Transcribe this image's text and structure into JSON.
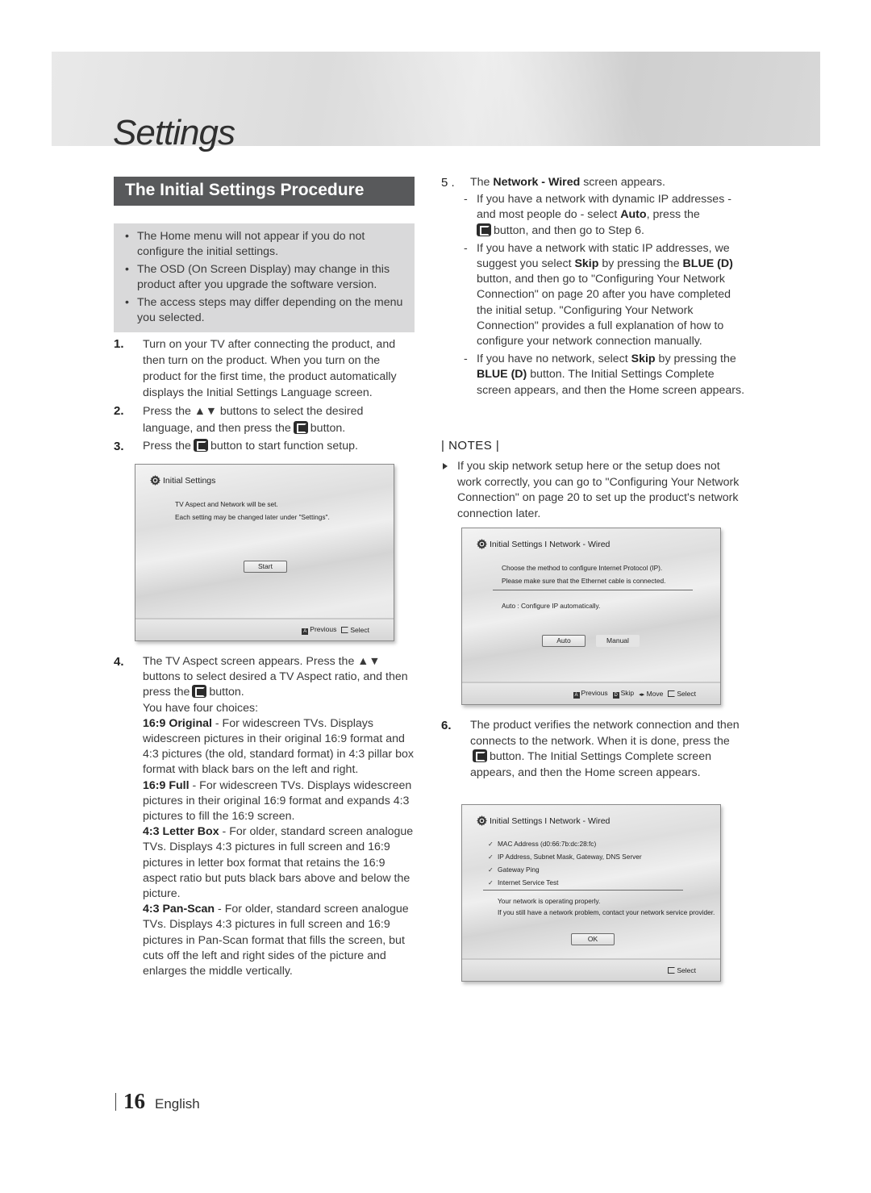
{
  "header": {
    "title": "Settings"
  },
  "section": {
    "title": "The Initial Settings Procedure"
  },
  "notes_box": {
    "items": [
      "The Home menu will not appear if you do not configure the initial settings.",
      "The OSD (On Screen Display) may change in this product after you upgrade the software version.",
      "The access steps may differ depending on the menu you selected."
    ]
  },
  "steps": {
    "s1": {
      "num": "1.",
      "text": "Turn on your TV after connecting the product, and then turn on the product. When you turn on the product for the first time, the product automatically displays the Initial Settings Language screen."
    },
    "s2": {
      "num": "2.",
      "pre": "Press the ▲▼ buttons to select the desired language, and then press the",
      "post": "button."
    },
    "s3": {
      "num": "3.",
      "pre": "Press the",
      "post": "button to start function setup."
    },
    "s4": {
      "num": "4.",
      "pre": "The TV Aspect screen appears. Press the ▲▼ buttons to select desired a TV Aspect ratio, and then press the",
      "post": "button.",
      "choices_intro": "You have four choices:",
      "choices": [
        {
          "name": "16:9 Original",
          "desc": " - For widescreen TVs. Displays widescreen pictures in their original 16:9 format and 4:3 pictures (the old, standard format) in 4:3 pillar box format with black bars on the left and right."
        },
        {
          "name": "16:9 Full",
          "desc": " - For widescreen TVs. Displays widescreen pictures in their original 16:9 format and expands 4:3 pictures to fill the 16:9 screen."
        },
        {
          "name": "4:3 Letter Box",
          "desc": " - For older, standard screen analogue TVs. Displays 4:3 pictures in full screen and 16:9 pictures in letter box format that retains the 16:9 aspect ratio but puts black bars above and below the picture."
        },
        {
          "name": "4:3 Pan-Scan",
          "desc": " - For older, standard screen analogue TVs. Displays 4:3 pictures in full screen and 16:9 pictures in Pan-Scan format that fills the screen, but cuts off the left and right sides of the picture and enlarges the middle vertically."
        }
      ]
    },
    "s5": {
      "num": "5 .",
      "pre": "The ",
      "bold": "Network - Wired",
      "post": " screen appears.",
      "sub1": {
        "a": "If you have a network with dynamic IP addresses - and most people do - select ",
        "b": "Auto",
        "c": ", press the",
        "d": "button, and then go to Step 6."
      },
      "sub2": {
        "a": "If you have a network with static IP addresses, we suggest you select ",
        "b": "Skip",
        "c": " by pressing the ",
        "d": "BLUE (D)",
        "e": " button, and then go to \"Configuring Your Network Connection\" on page 20 after you have completed the initial setup. \"Configuring Your Network Connection\" provides a full explanation of how to configure your network connection manually."
      },
      "sub3": {
        "a": "If you have no network, select ",
        "b": "Skip",
        "c": " by pressing the ",
        "d": "BLUE (D)",
        "e": " button. The Initial Settings Complete screen appears, and then the Home screen appears."
      }
    },
    "s6": {
      "num": "6.",
      "pre": "The product verifies the network connection and then connects to the network. When it is done, press the",
      "post": "button. The Initial Settings Complete screen appears, and then the Home screen appears."
    }
  },
  "notes": {
    "heading": "| NOTES |",
    "item": "If you skip network setup here or the setup does not work correctly, you can go to \"Configuring Your Network Connection\" on page 20 to set up the product's network connection later."
  },
  "osd1": {
    "title": "Initial Settings",
    "line1": "TV Aspect and Network will be set.",
    "line2": "Each setting may be changed later under \"Settings\".",
    "start": "Start",
    "footer": {
      "previous_key": "A",
      "previous": "Previous",
      "select": "Select"
    }
  },
  "osd2": {
    "title": "Initial Settings I Network - Wired",
    "line1": "Choose the method to configure Internet Protocol (IP).",
    "line2": "Please make sure that the Ethernet cable is connected.",
    "line3": "Auto : Configure IP automatically.",
    "auto": "Auto",
    "manual": "Manual",
    "footer": {
      "previous_key": "A",
      "previous": "Previous",
      "skip_key": "D",
      "skip": "Skip",
      "move_glyph": "◂▸",
      "move": "Move",
      "select": "Select"
    }
  },
  "osd3": {
    "title": "Initial Settings I Network - Wired",
    "checks": [
      "MAC Address (d0:66:7b:dc:28:fc)",
      "IP Address, Subnet Mask, Gateway, DNS Server",
      "Gateway Ping",
      "Internet Service Test"
    ],
    "msg1": "Your network is operating properly.",
    "msg2": "If you still have a network problem, contact your network service provider.",
    "ok": "OK",
    "footer": {
      "select": "Select"
    }
  },
  "footer": {
    "page": "16",
    "language": "English"
  }
}
